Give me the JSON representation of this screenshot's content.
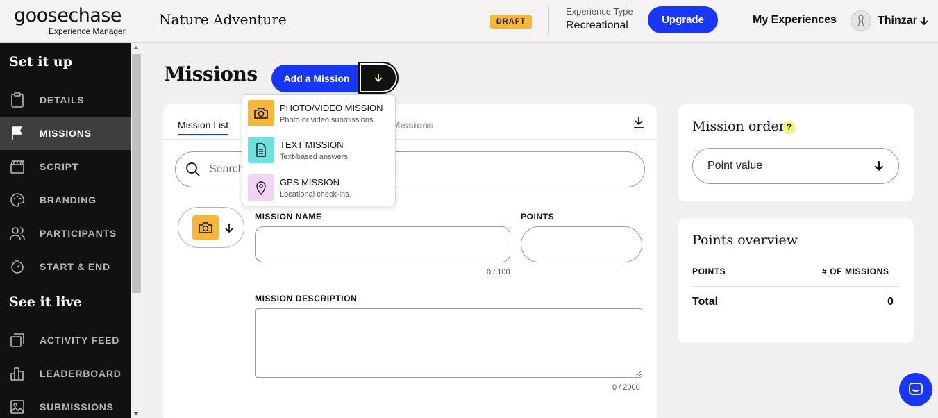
{
  "header": {
    "logo_main": "goosechase",
    "logo_sub": "Experience Manager",
    "experience_title": "Nature Adventure",
    "status_badge": "DRAFT",
    "experience_type_label": "Experience Type",
    "experience_type_value": "Recreational",
    "upgrade_label": "Upgrade",
    "my_experiences_label": "My Experiences",
    "username": "Thinzar"
  },
  "sidebar": {
    "section1": "Set it up",
    "section2": "See it live",
    "items": [
      {
        "label": "DETAILS",
        "icon": "clipboard-icon"
      },
      {
        "label": "MISSIONS",
        "icon": "flag-icon",
        "active": true
      },
      {
        "label": "SCRIPT",
        "icon": "clapperboard-icon"
      },
      {
        "label": "BRANDING",
        "icon": "palette-icon"
      },
      {
        "label": "PARTICIPANTS",
        "icon": "users-icon"
      },
      {
        "label": "START & END",
        "icon": "stopwatch-icon"
      },
      {
        "label": "ACTIVITY FEED",
        "icon": "feed-icon"
      },
      {
        "label": "LEADERBOARD",
        "icon": "bar-chart-icon"
      },
      {
        "label": "SUBMISSIONS",
        "icon": "image-icon"
      }
    ]
  },
  "main": {
    "page_title": "Missions",
    "add_mission_label": "Add a Mission",
    "tabs": {
      "mission_list": "Mission List",
      "other_tab_visible": "s Missions"
    },
    "search_placeholder": "Search",
    "form": {
      "mission_name_label": "MISSION NAME",
      "points_label": "POINTS",
      "name_counter": "0 / 100",
      "description_label": "MISSION DESCRIPTION",
      "description_counter": "0 / 2000"
    }
  },
  "dropdown": {
    "items": [
      {
        "title": "PHOTO/VIDEO MISSION",
        "desc": "Photo or video submissions.",
        "color": "#f5b73b",
        "icon": "camera-icon"
      },
      {
        "title": "TEXT MISSION",
        "desc": "Text-based answers.",
        "color": "#6fe0e0",
        "icon": "document-icon"
      },
      {
        "title": "GPS MISSION",
        "desc": "Locational check-ins.",
        "color": "#f2d4f7",
        "icon": "map-pin-icon"
      }
    ]
  },
  "mission_order": {
    "title": "Mission order",
    "help": "?",
    "selected": "Point value"
  },
  "points_overview": {
    "title": "Points overview",
    "col_points": "POINTS",
    "col_missions": "# OF MISSIONS",
    "total_label": "Total",
    "total_value": "0"
  },
  "colors": {
    "accent": "#1737f5",
    "draft": "#f5b73b",
    "sidebar_bg": "#111111"
  }
}
